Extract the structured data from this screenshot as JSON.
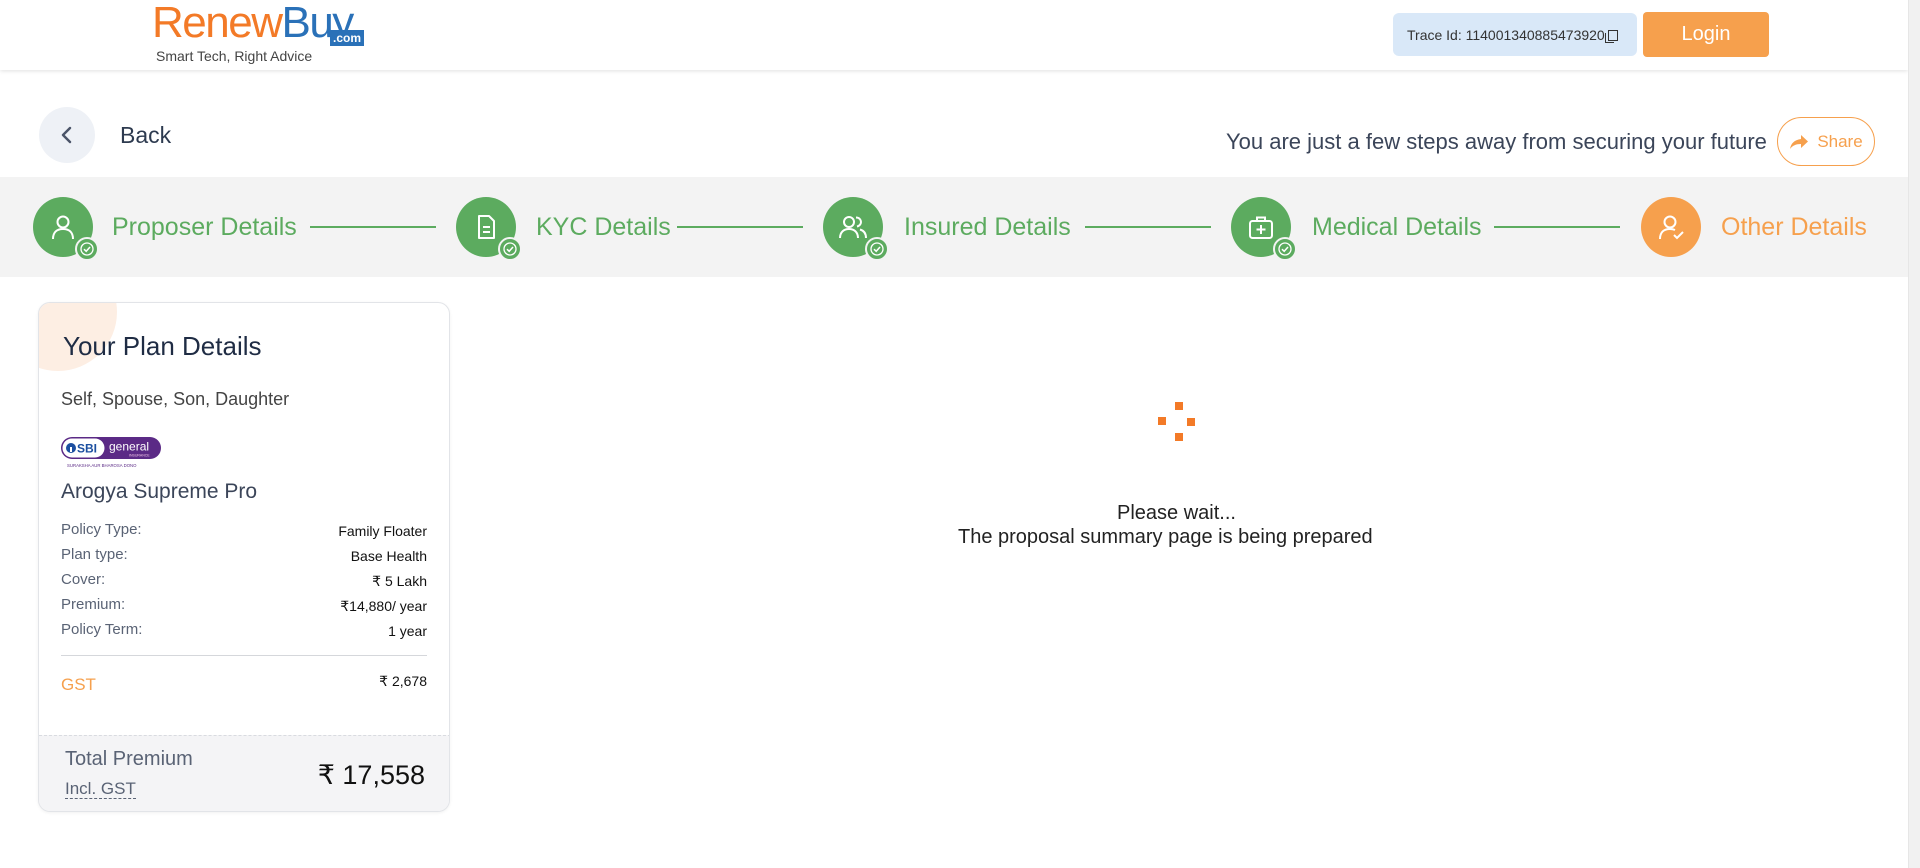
{
  "header": {
    "logo": {
      "brand_left": "Renew",
      "brand_right": "Buy",
      "domain": ".com",
      "tagline": "Smart Tech, Right Advice"
    },
    "trace_label": "Trace Id: 114001340885473920",
    "login_label": "Login"
  },
  "nav": {
    "back_label": "Back",
    "tagline": "You are just a few steps away from securing your future",
    "share_label": "Share"
  },
  "steps": [
    {
      "label": "Proposer Details",
      "icon": "user-icon",
      "status": "done"
    },
    {
      "label": "KYC Details",
      "icon": "document-icon",
      "status": "done"
    },
    {
      "label": "Insured Details",
      "icon": "users-icon",
      "status": "done"
    },
    {
      "label": "Medical Details",
      "icon": "medical-kit-icon",
      "status": "done"
    },
    {
      "label": "Other Details",
      "icon": "user-check-icon",
      "status": "active"
    }
  ],
  "plan": {
    "title": "Your Plan Details",
    "members": "Self, Spouse, Son, Daughter",
    "insurer_logo": {
      "brand": "SBI",
      "word": "general",
      "sub": "INSURANCE",
      "motto": "SURAKSHA AUR BHAROSA DONO"
    },
    "plan_name": "Arogya Supreme Pro",
    "rows": [
      {
        "key": "Policy Type:",
        "value": "Family Floater"
      },
      {
        "key": "Plan type:",
        "value": "Base Health"
      },
      {
        "key": "Cover:",
        "value": "₹ 5 Lakh"
      },
      {
        "key": "Premium:",
        "value": "₹14,880/ year"
      },
      {
        "key": "Policy Term:",
        "value": "1 year"
      }
    ],
    "gst_label": "GST",
    "gst_value": "₹ 2,678",
    "total_label": "Total Premium",
    "total_sublabel": "Incl. GST",
    "total_value": "₹ 17,558"
  },
  "loader": {
    "line1": "Please wait...",
    "line2": "The proposal summary page is being prepared"
  },
  "colors": {
    "primary_orange": "#f6a04d",
    "logo_orange": "#f37a27",
    "logo_blue": "#2a71b8",
    "step_green": "#5cab5f",
    "trace_bg": "#d9e8f8"
  }
}
